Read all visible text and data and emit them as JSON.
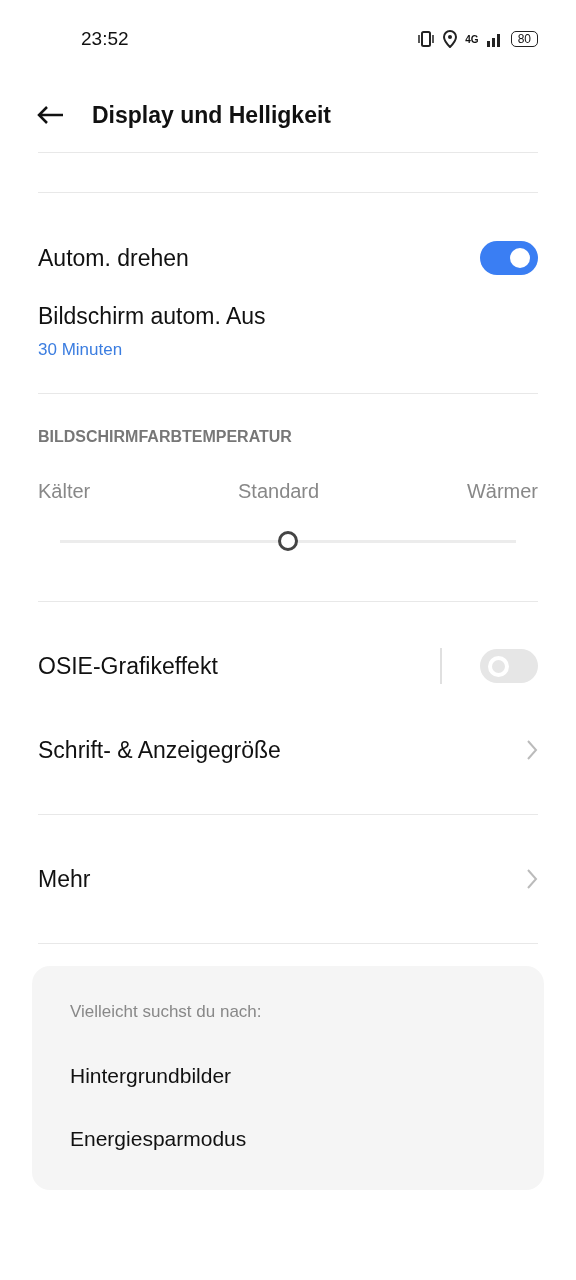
{
  "status_bar": {
    "time": "23:52",
    "network": "4G",
    "battery": "80"
  },
  "header": {
    "title": "Display und Helligkeit"
  },
  "rotate": {
    "label": "Autom. drehen",
    "on": true
  },
  "screen_off": {
    "label": "Bildschirm autom. Aus",
    "value": "30 Minuten"
  },
  "color_temperature": {
    "heading": "BILDSCHIRMFARBTEMPERATUR",
    "labels": [
      "Kälter",
      "Standard",
      "Wärmer"
    ],
    "level": 0.5
  },
  "items": [
    {
      "kind": "toggle",
      "label": "OSIE-Grafikeffekt",
      "on": false
    },
    {
      "kind": "link",
      "label": "Schrift- & Anzeigegröße"
    },
    {
      "kind": "divider"
    },
    {
      "kind": "link",
      "label": "Mehr"
    },
    {
      "kind": "divider"
    }
  ],
  "suggestions": {
    "heading": "Vielleicht suchst du nach:",
    "items": [
      "Hintergrundbilder",
      "Energiesparmodus"
    ]
  }
}
